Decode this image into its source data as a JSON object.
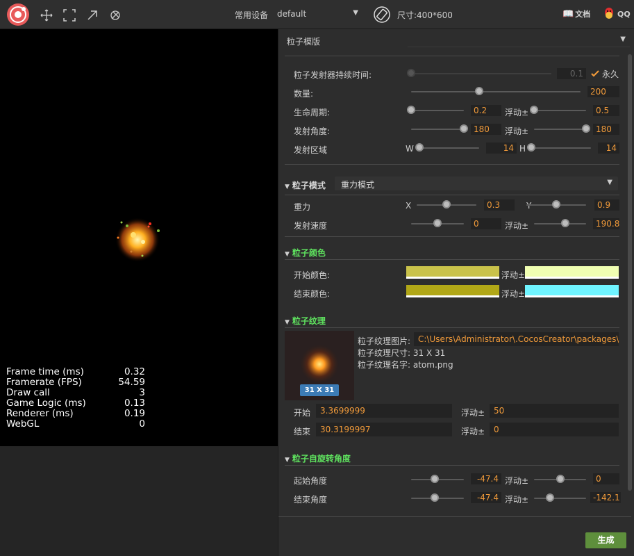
{
  "toolbar": {
    "device_label": "常用设备",
    "device_value": "default",
    "size_label": "尺寸:400*600",
    "docs_label": "文档",
    "qq_label": "QQ"
  },
  "stats": [
    {
      "label": "Frame time (ms)",
      "value": "0.32"
    },
    {
      "label": "Framerate (FPS)",
      "value": "54.59"
    },
    {
      "label": "Draw call",
      "value": "3"
    },
    {
      "label": "Game Logic (ms)",
      "value": "0.13"
    },
    {
      "label": "Renderer (ms)",
      "value": "0.19"
    },
    {
      "label": "WebGL",
      "value": "0"
    }
  ],
  "template": {
    "label": "粒子模版",
    "value": ""
  },
  "emitter": {
    "duration_label": "粒子发射器持续时间:",
    "duration_value": "0.1",
    "duration_slider": 0.0,
    "forever_label": "永久",
    "forever_checked": true,
    "count_label": "数量:",
    "count_value": "200",
    "count_slider": 0.4,
    "life_label": "生命周期:",
    "life_value": "0.2",
    "life_slider": 0.0,
    "life_var_label": "浮动±",
    "life_var_value": "0.5",
    "life_var_slider": 0.0,
    "angle_label": "发射角度:",
    "angle_value": "180",
    "angle_slider": 1.0,
    "angle_var_label": "浮动±",
    "angle_var_value": "180",
    "angle_var_slider": 1.0,
    "area_label": "发射区域",
    "w_label": "W",
    "w_value": "14",
    "w_slider": 0.0,
    "h_label": "H",
    "h_value": "14",
    "h_slider": 0.0
  },
  "mode": {
    "label": "粒子模式",
    "value": "重力模式",
    "gravity_label": "重力",
    "x_label": "X",
    "x_value": "0.3",
    "x_slider": 0.5,
    "y_label": "Y",
    "y_value": "0.9",
    "y_slider": 0.5,
    "speed_label": "发射速度",
    "speed_value": "0",
    "speed_slider": 0.5,
    "speed_var_label": "浮动±",
    "speed_var_value": "190.8",
    "speed_var_slider": 0.6
  },
  "color": {
    "label": "粒子颜色",
    "start_label": "开始颜色:",
    "start_color": "#c9c24a",
    "start_var_label": "浮动±",
    "start_var_color": "#f0ffb2",
    "end_label": "结束颜色:",
    "end_color": "#b1a717",
    "end_var_label": "浮动±",
    "end_var_color": "#6ff4ff"
  },
  "texture": {
    "label": "粒子纹理",
    "image_label": "粒子纹理图片:",
    "image_path": "C:\\Users\\Administrator\\.CocosCreator\\packages\\cocc",
    "size_label": "粒子纹理尺寸: 31 X 31",
    "name_label": "粒子纹理名字: atom.png",
    "thumb_badge": "31 X 31",
    "start_label": "开始",
    "start_value": "3.3699999",
    "start_var_label": "浮动±",
    "start_var_value": "50",
    "end_label": "结束",
    "end_value": "30.3199997",
    "end_var_label": "浮动±",
    "end_var_value": "0"
  },
  "rotation": {
    "label": "粒子自旋转角度",
    "start_label": "起始角度",
    "start_value": "-47.4",
    "start_slider": 0.45,
    "start_var_label": "浮动±",
    "start_var_value": "0",
    "start_var_slider": 0.5,
    "end_label": "结束角度",
    "end_value": "-47.4",
    "end_slider": 0.45,
    "end_var_label": "浮动±",
    "end_var_value": "-142.1",
    "end_var_slider": 0.3
  },
  "generate_label": "生成",
  "colors": {
    "accent": "#f09a3a",
    "section": "#5fe35f",
    "button": "#5e8f3c"
  }
}
